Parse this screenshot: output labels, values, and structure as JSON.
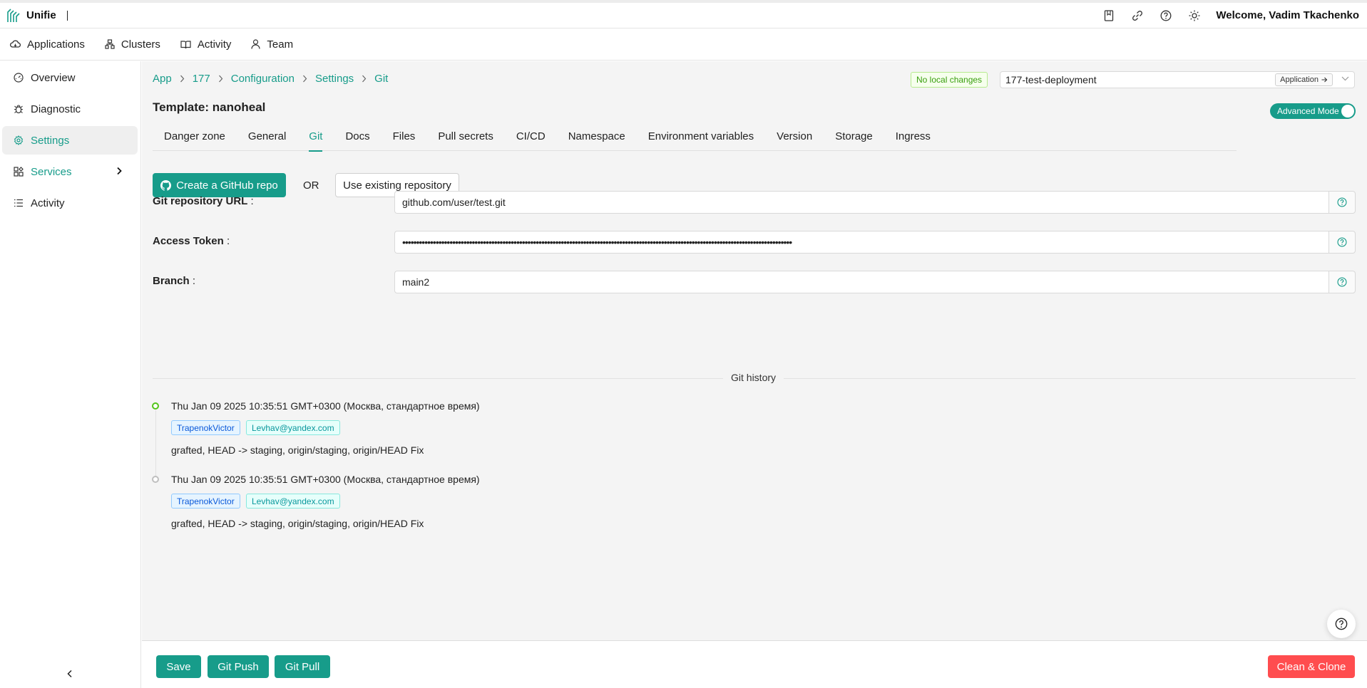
{
  "app": {
    "name": "Unifie",
    "welcome": "Welcome, Vadim Tkachenko"
  },
  "topnav": {
    "items": [
      {
        "label": "Applications",
        "icon": "cloud-icon"
      },
      {
        "label": "Clusters",
        "icon": "cluster-icon"
      },
      {
        "label": "Activity",
        "icon": "book-icon"
      },
      {
        "label": "Team",
        "icon": "user-icon"
      }
    ]
  },
  "sidebar": {
    "items": [
      {
        "label": "Overview",
        "icon": "dashboard-icon"
      },
      {
        "label": "Diagnostic",
        "icon": "bug-icon"
      },
      {
        "label": "Settings",
        "icon": "gear-icon"
      },
      {
        "label": "Services",
        "icon": "services-icon"
      },
      {
        "label": "Activity",
        "icon": "list-icon"
      }
    ]
  },
  "breadcrumb": [
    "App",
    "177",
    "Configuration",
    "Settings",
    "Git"
  ],
  "status": {
    "local_changes": "No local changes"
  },
  "deployment": {
    "selected": "177-test-deployment",
    "app_button": "Application"
  },
  "template": {
    "title": "Template: nanoheal"
  },
  "advanced_mode": {
    "label": "Advanced Mode",
    "on": true
  },
  "tabs": [
    {
      "label": "Danger zone"
    },
    {
      "label": "General"
    },
    {
      "label": "Git"
    },
    {
      "label": "Docs"
    },
    {
      "label": "Files"
    },
    {
      "label": "Pull secrets"
    },
    {
      "label": "CI/CD"
    },
    {
      "label": "Namespace"
    },
    {
      "label": "Environment variables"
    },
    {
      "label": "Version"
    },
    {
      "label": "Storage"
    },
    {
      "label": "Ingress"
    }
  ],
  "active_tab": "Git",
  "git": {
    "create_repo_label": "Create a GitHub repo",
    "or_label": "OR",
    "use_existing_label": "Use existing repository",
    "fields": {
      "url": {
        "label": "Git repository URL",
        "value": "github.com/user/test.git"
      },
      "token": {
        "label": "Access Token",
        "value": "••••••••••••••••••••••••••••••••••••••••••••••••••••••••••••••••••••••••••••••••••••••••••••••••••••••••••••••••••••••••••••••••••••••••••••"
      },
      "branch": {
        "label": "Branch",
        "value": "main2"
      }
    },
    "history_title": "Git history",
    "history": [
      {
        "date": "Thu Jan 09 2025 10:35:51 GMT+0300 (Москва, стандартное время)",
        "author": "TrapenokVictor",
        "email": "Levhav@yandex.com",
        "message": "grafted, HEAD -> staging, origin/staging, origin/HEAD Fix",
        "dot_color": "#52c41a"
      },
      {
        "date": "Thu Jan 09 2025 10:35:51 GMT+0300 (Москва, стандартное время)",
        "author": "TrapenokVictor",
        "email": "Levhav@yandex.com",
        "message": "grafted, HEAD -> staging, origin/staging, origin/HEAD Fix",
        "dot_color": "#bfbfbf"
      }
    ]
  },
  "footer": {
    "save": "Save",
    "push": "Git Push",
    "pull": "Git Pull",
    "clean_clone": "Clean & Clone"
  },
  "colors": {
    "accent": "#179c8a",
    "danger": "#ff4d4f",
    "success": "#52c41a"
  }
}
